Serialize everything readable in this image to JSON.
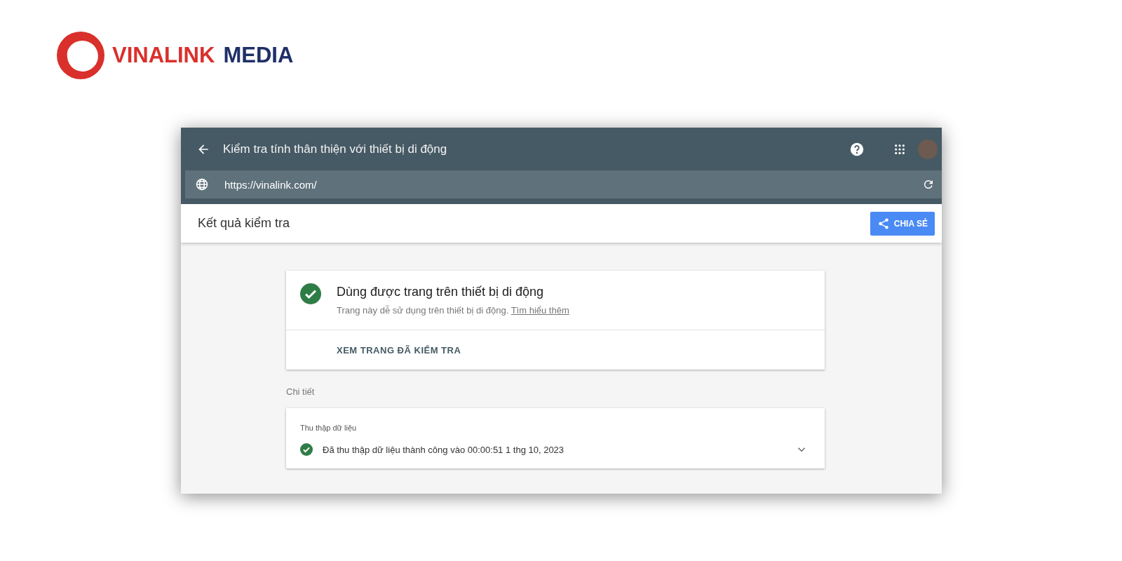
{
  "logo": {
    "brand": "VINALINK",
    "suffix": "MEDIA"
  },
  "window": {
    "title": "Kiểm tra tính thân thiện với thiết bị di động",
    "url": "https://vinalink.com/"
  },
  "results_bar": {
    "title": "Kết quả kiểm tra",
    "share_button": "CHIA SẺ"
  },
  "result_card": {
    "heading": "Dùng được trang trên thiết bị di động",
    "description": "Trang này dễ sử dụng trên thiết bị di động.",
    "link": "Tìm hiểu thêm",
    "action": "XEM TRANG ĐÃ KIỂM TRA"
  },
  "details": {
    "label": "Chi tiết",
    "card_title": "Thu thập dữ liệu",
    "status": "Đã thu thập dữ liệu thành công vào 00:00:51 1 thg 10, 2023",
    "expanded": false
  }
}
